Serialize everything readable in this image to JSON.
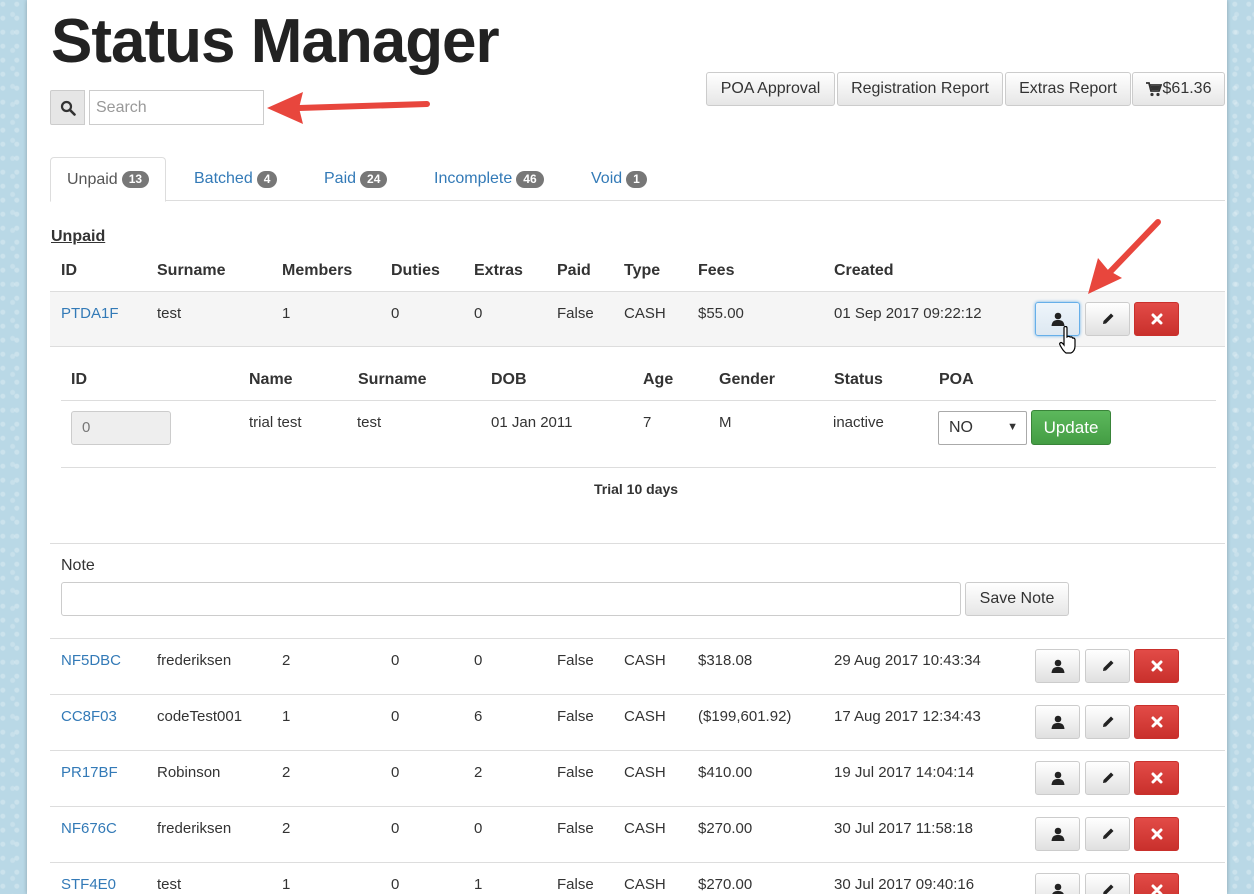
{
  "app": {
    "title": "Status Manager",
    "search_placeholder": "Search"
  },
  "header_buttons": {
    "poa": "POA Approval",
    "registration": "Registration Report",
    "extras": "Extras Report",
    "cart": "$61.36"
  },
  "tabs": [
    {
      "label": "Unpaid",
      "count": "13"
    },
    {
      "label": "Batched",
      "count": "4"
    },
    {
      "label": "Paid",
      "count": "24"
    },
    {
      "label": "Incomplete",
      "count": "46"
    },
    {
      "label": "Void",
      "count": "1"
    }
  ],
  "section_title": "Unpaid",
  "columns": [
    "ID",
    "Surname",
    "Members",
    "Duties",
    "Extras",
    "Paid",
    "Type",
    "Fees",
    "Created"
  ],
  "expanded_row": {
    "id": "PTDA1F",
    "surname": "test",
    "members": "1",
    "duties": "0",
    "extras": "0",
    "paid": "False",
    "type": "CASH",
    "fees": "$55.00",
    "created": "01 Sep 2017 09:22:12"
  },
  "member_columns": [
    "ID",
    "Name",
    "Surname",
    "DOB",
    "Age",
    "Gender",
    "Status",
    "POA"
  ],
  "member": {
    "id": "0",
    "name": "trial test",
    "surname": "test",
    "dob": "01 Jan 2011",
    "age": "7",
    "gender": "M",
    "status": "inactive",
    "poa_selected": "NO",
    "update_label": "Update"
  },
  "trial_text": "Trial 10 days",
  "note": {
    "label": "Note",
    "value": "",
    "save_label": "Save Note"
  },
  "rows": [
    {
      "id": "NF5DBC",
      "surname": "frederiksen",
      "members": "2",
      "duties": "0",
      "extras": "0",
      "paid": "False",
      "type": "CASH",
      "fees": "$318.08",
      "created": "29 Aug 2017 10:43:34"
    },
    {
      "id": "CC8F03",
      "surname": "codeTest001",
      "members": "1",
      "duties": "0",
      "extras": "6",
      "paid": "False",
      "type": "CASH",
      "fees": "($199,601.92)",
      "created": "17 Aug 2017 12:34:43"
    },
    {
      "id": "PR17BF",
      "surname": "Robinson",
      "members": "2",
      "duties": "0",
      "extras": "2",
      "paid": "False",
      "type": "CASH",
      "fees": "$410.00",
      "created": "19 Jul 2017 14:04:14"
    },
    {
      "id": "NF676C",
      "surname": "frederiksen",
      "members": "2",
      "duties": "0",
      "extras": "0",
      "paid": "False",
      "type": "CASH",
      "fees": "$270.00",
      "created": "30 Jul 2017 11:58:18"
    },
    {
      "id": "STF4E0",
      "surname": "test",
      "members": "1",
      "duties": "0",
      "extras": "1",
      "paid": "False",
      "type": "CASH",
      "fees": "$270.00",
      "created": "30 Jul 2017 09:40:16"
    }
  ],
  "colors": {
    "link": "#337ab7",
    "danger": "#d9534f",
    "success": "#5cb85c",
    "annotation_arrow": "#e8463d"
  }
}
